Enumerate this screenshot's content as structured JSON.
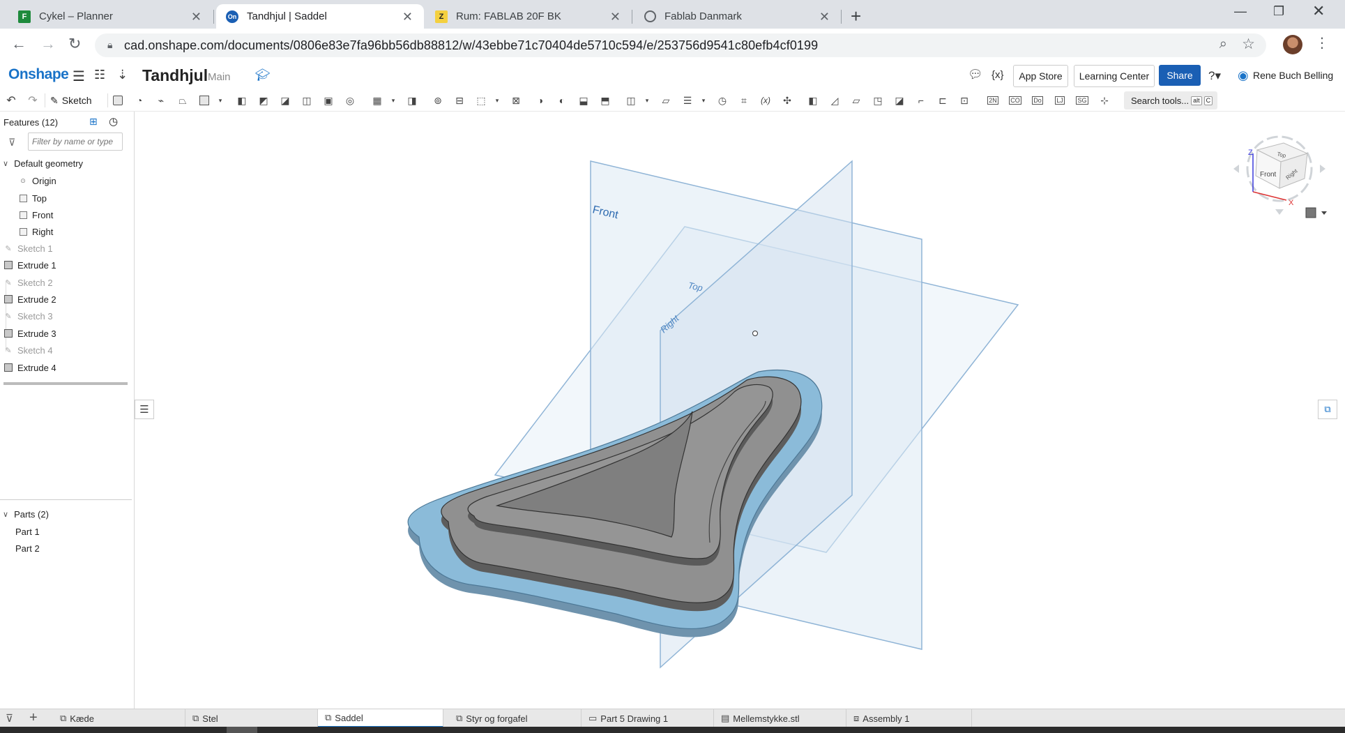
{
  "browser": {
    "tabs": [
      {
        "title": "Cykel – Planner",
        "icon": "planner-icon"
      },
      {
        "title": "Tandhjul | Saddel",
        "icon": "onshape-icon"
      },
      {
        "title": "Rum: FABLAB 20F BK",
        "icon": "z-icon"
      },
      {
        "title": "Fablab Danmark",
        "icon": "globe-icon"
      }
    ],
    "url": "cad.onshape.com/documents/0806e83e7fa96bb56db88812/w/43ebbe71c70404de5710c594/e/253756d9541c80efb4cf0199"
  },
  "header": {
    "logo": "Onshape",
    "title": "Tandhjul",
    "branch": "Main",
    "app_store": "App Store",
    "learning_center": "Learning Center",
    "share": "Share",
    "user": "Rene Buch Belling"
  },
  "toolbar": {
    "sketch_label": "Sketch",
    "search_label": "Search tools...",
    "search_kbd1": "alt",
    "search_kbd2": "C"
  },
  "features": {
    "header": "Features (12)",
    "filter_placeholder": "Filter by name or type",
    "group": "Default geometry",
    "default_items": [
      "Origin",
      "Top",
      "Front",
      "Right"
    ],
    "items": [
      "Sketch 1",
      "Extrude 1",
      "Sketch 2",
      "Extrude 2",
      "Sketch 3",
      "Extrude 3",
      "Sketch 4",
      "Extrude 4"
    ]
  },
  "parts": {
    "header": "Parts (2)",
    "items": [
      "Part 1",
      "Part 2"
    ]
  },
  "viewport": {
    "plane_labels": {
      "front": "Front",
      "top": "Top",
      "right": "Right"
    },
    "view_cube": {
      "top": "Top",
      "front": "Front",
      "right": "Right",
      "axis_z": "Z",
      "axis_x": "X"
    }
  },
  "bottom_tabs": [
    "Kæde",
    "Stel",
    "Saddel",
    "Styr og forgafel",
    "Part 5 Drawing 1",
    "Mellemstykke.stl",
    "Assembly 1"
  ],
  "active_bottom_tab": "Saddel",
  "colors": {
    "onshape_blue": "#1a73c8",
    "share_blue": "#1a5fb4",
    "part_blue": "#8bbbd9",
    "part_gray": "#8e8e8e"
  }
}
